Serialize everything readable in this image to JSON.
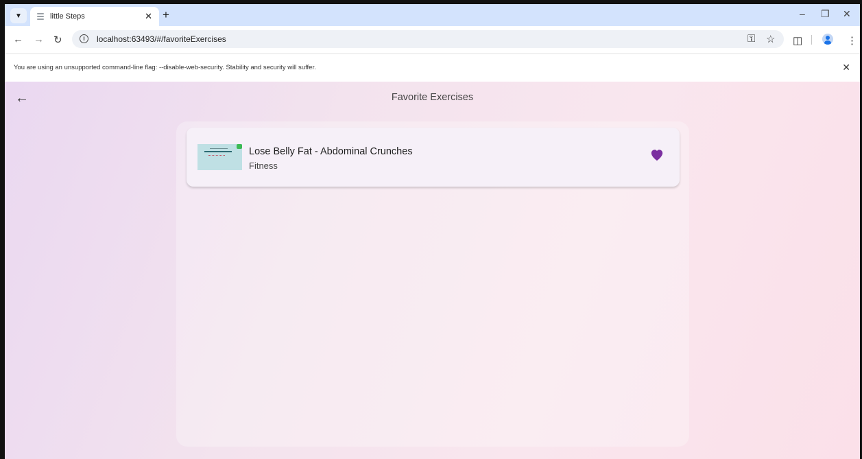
{
  "browser": {
    "tab_title": "little Steps",
    "url": "localhost:63493/#/favoriteExercises",
    "infobar_text": "You are using an unsupported command-line flag: --disable-web-security. Stability and security will suffer."
  },
  "app": {
    "title": "Favorite Exercises",
    "favorites": [
      {
        "title": "Lose Belly Fat - Abdominal Crunches",
        "category": "Fitness",
        "favorited": true
      }
    ]
  },
  "colors": {
    "heart": "#7b2fa0",
    "gradient_left": "#ead8f1",
    "gradient_right": "#fbe0e9"
  },
  "icons": [
    "tab-menu-chevron-icon",
    "tab-favicon-icon",
    "close-icon",
    "plus-icon",
    "minimize-icon",
    "restore-icon",
    "back-arrow-icon",
    "forward-arrow-icon",
    "reload-icon",
    "info-icon",
    "key-icon",
    "star-icon",
    "extensions-icon",
    "profile-icon",
    "more-vert-icon",
    "heart-icon"
  ]
}
